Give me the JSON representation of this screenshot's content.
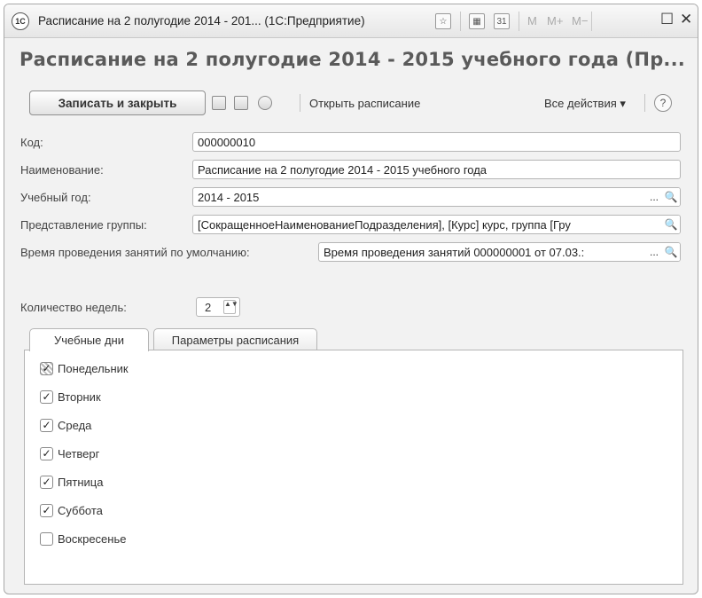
{
  "window": {
    "app_logo": "1С",
    "title": "Расписание на 2 полугодие 2014 - 201... (1С:Предприятие)",
    "calendar_day": "31",
    "m_label": "M",
    "m_plus_label": "M+",
    "m_minus_label": "M−",
    "maximize_glyph": "☐",
    "close_glyph": "✕"
  },
  "form": {
    "heading": "Расписание на 2 полугодие 2014 - 2015 учебного года (Пр..."
  },
  "toolbar": {
    "save_close_label": "Записать и закрыть",
    "open_schedule_label": "Открыть расписание",
    "all_actions_label": "Все действия ▾",
    "help_glyph": "?"
  },
  "fields": {
    "code": {
      "label": "Код:",
      "value": "000000010"
    },
    "name": {
      "label": "Наименование:",
      "value": "Расписание на 2 полугодие 2014 - 2015 учебного года"
    },
    "year": {
      "label": "Учебный год:",
      "value": "2014 - 2015",
      "select_glyph": "...",
      "search_glyph": "🔍"
    },
    "group_view": {
      "label": "Представление группы:",
      "value": "[СокращенноеНаименованиеПодразделения], [Курс] курс, группа [Гру",
      "search_glyph": "🔍"
    },
    "lesson_time": {
      "label": "Время проведения занятий по умолчанию:",
      "value": "Время проведения занятий 000000001 от 07.03.:",
      "select_glyph": "...",
      "search_glyph": "🔍"
    },
    "weeks": {
      "label": "Количество недель:",
      "value": "2",
      "arrows": "▲▼"
    }
  },
  "tabs": [
    {
      "label": "Учебные дни",
      "active": true
    },
    {
      "label": "Параметры расписания",
      "active": false
    }
  ],
  "days": [
    {
      "label": "Понедельник",
      "state": "mixed",
      "mark": "✓"
    },
    {
      "label": "Вторник",
      "state": "checked",
      "mark": "✓"
    },
    {
      "label": "Среда",
      "state": "checked",
      "mark": "✓"
    },
    {
      "label": "Четверг",
      "state": "checked",
      "mark": "✓"
    },
    {
      "label": "Пятница",
      "state": "checked",
      "mark": "✓"
    },
    {
      "label": "Суббота",
      "state": "checked",
      "mark": "✓"
    },
    {
      "label": "Воскресенье",
      "state": "unchecked",
      "mark": ""
    }
  ]
}
